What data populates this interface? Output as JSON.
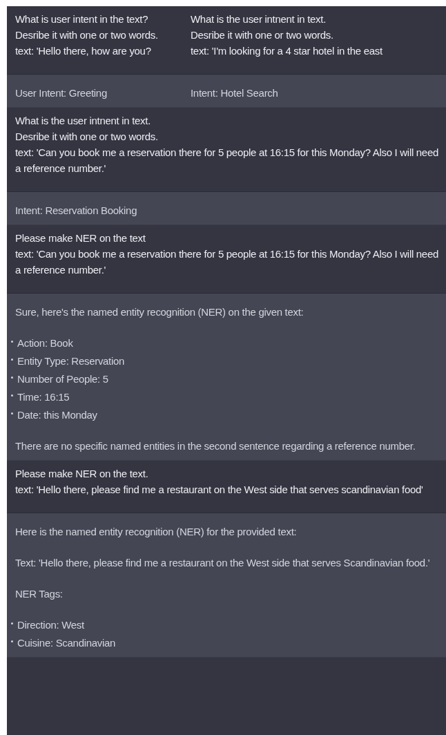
{
  "messages": [
    {
      "kind": "user",
      "columns": [
        {
          "blocks": [
            {
              "kind": "lines",
              "lines": [
                "What is user intent in the text?",
                "Desribe it with one or two words.",
                "text: 'Hello there, how are you?"
              ]
            }
          ]
        },
        {
          "blocks": [
            {
              "kind": "lines",
              "lines": [
                "What is the user intnent in text.",
                "Desribe it with one or two words.",
                "text: 'I'm looking for a 4 star hotel in the east"
              ]
            }
          ]
        }
      ]
    },
    {
      "kind": "assistant",
      "columns": [
        {
          "blocks": [
            {
              "kind": "paragraph",
              "text": "User Intent: Greeting"
            }
          ]
        },
        {
          "blocks": [
            {
              "kind": "paragraph",
              "text": "Intent: Hotel Search"
            }
          ]
        }
      ]
    },
    {
      "kind": "user",
      "columns": [
        {
          "blocks": [
            {
              "kind": "lines",
              "lines": [
                "What is the user intnent in text.",
                "Desribe it with one or two words.",
                "text: 'Can you book me a reservation there for 5 people at 16:15 for this Monday? Also I will need a reference number.'"
              ]
            }
          ]
        }
      ]
    },
    {
      "kind": "assistant",
      "columns": [
        {
          "blocks": [
            {
              "kind": "paragraph",
              "text": "Intent: Reservation Booking"
            }
          ]
        }
      ]
    },
    {
      "kind": "user",
      "columns": [
        {
          "blocks": [
            {
              "kind": "lines",
              "lines": [
                "Please make NER on the text",
                "text: 'Can you book me a reservation there for 5 people at 16:15 for this Monday? Also I will need a reference number.'"
              ]
            }
          ]
        }
      ]
    },
    {
      "kind": "assistant",
      "columns": [
        {
          "blocks": [
            {
              "kind": "paragraph",
              "text": "Sure, here's the named entity recognition (NER) on the given text:"
            },
            {
              "kind": "list",
              "items": [
                "Action: Book",
                "Entity Type: Reservation",
                "Number of People: 5",
                "Time: 16:15",
                "Date: this Monday"
              ]
            },
            {
              "kind": "paragraph",
              "text": "There are no specific named entities in the second sentence regarding a reference number."
            }
          ]
        }
      ]
    },
    {
      "kind": "user",
      "columns": [
        {
          "blocks": [
            {
              "kind": "lines",
              "lines": [
                "Please make NER on the text.",
                "text: 'Hello there, please find me a restaurant on the West side that serves scandinavian food'"
              ]
            }
          ]
        }
      ]
    },
    {
      "kind": "assistant",
      "columns": [
        {
          "blocks": [
            {
              "kind": "paragraph",
              "text": "Here is the named entity recognition (NER) for the provided text:"
            },
            {
              "kind": "paragraph",
              "text": "Text: 'Hello there, please find me a restaurant on the West side that serves Scandinavian food.'"
            },
            {
              "kind": "paragraph",
              "text": "NER Tags:"
            },
            {
              "kind": "list",
              "items": [
                "Direction: West",
                "Cuisine: Scandinavian"
              ]
            }
          ]
        }
      ]
    }
  ]
}
